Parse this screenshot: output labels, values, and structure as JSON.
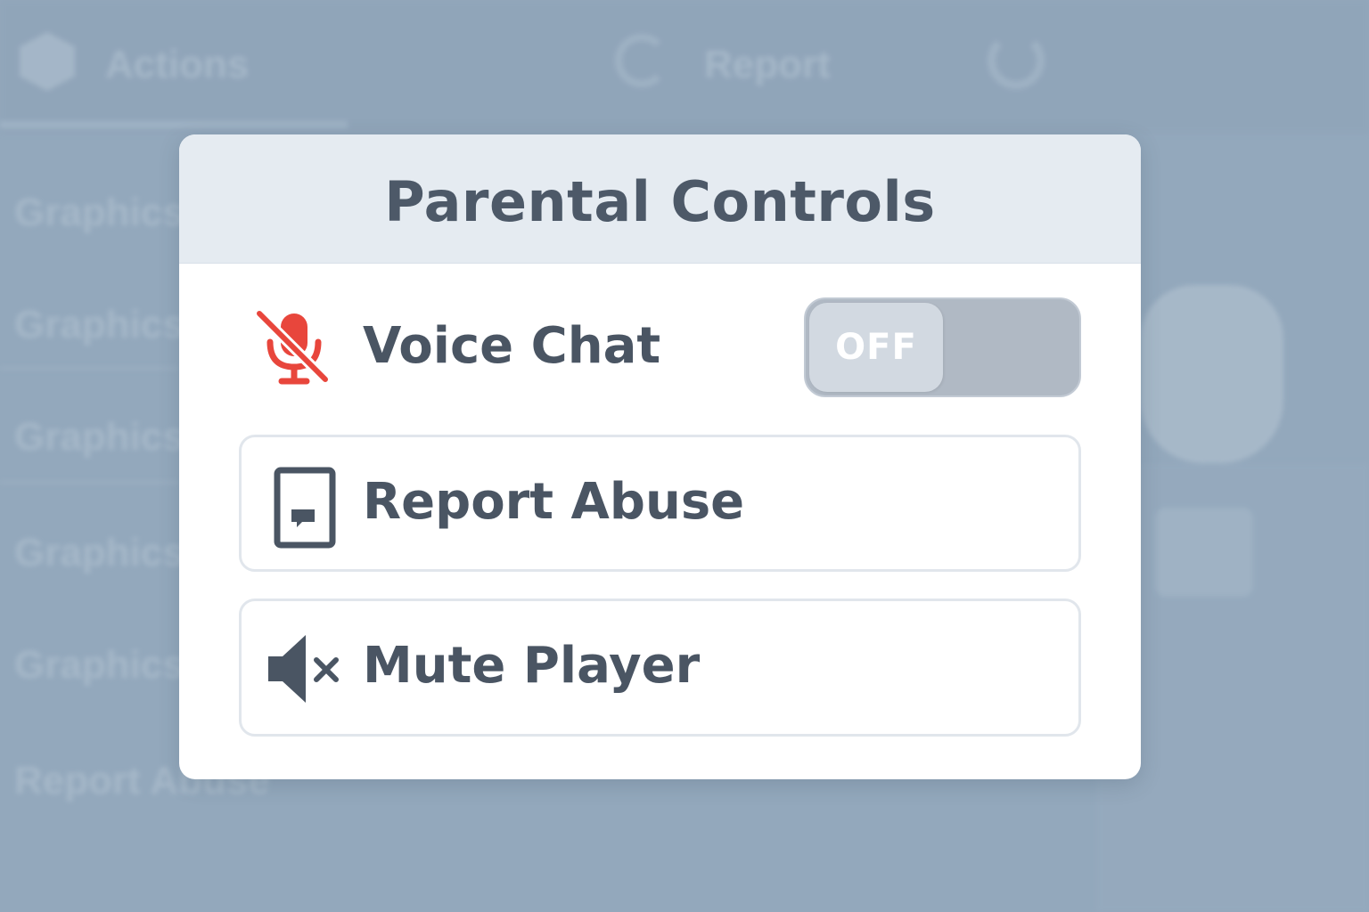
{
  "background": {
    "topbar": {
      "actions_label": "Actions",
      "report_label": "Report"
    },
    "sidebar_items": [
      "Graphics",
      "Graphics",
      "Graphics",
      "Graphics",
      "Graphics",
      "Report Abuse"
    ]
  },
  "dialog": {
    "title": "Parental Controls",
    "voice_chat": {
      "label": "Voice Chat",
      "toggle_state": "OFF",
      "icon": "muted-microphone-icon"
    },
    "report_abuse": {
      "label": "Report Abuse",
      "icon": "report-flag-icon"
    },
    "mute_player": {
      "label": "Mute Player",
      "icon": "speaker-muted-icon"
    }
  },
  "colors": {
    "background": "#93a8bc",
    "header": "#e5ebf1",
    "text": "#4a5563",
    "mic_red": "#e8463c",
    "toggle_off": "#b0b9c4"
  }
}
